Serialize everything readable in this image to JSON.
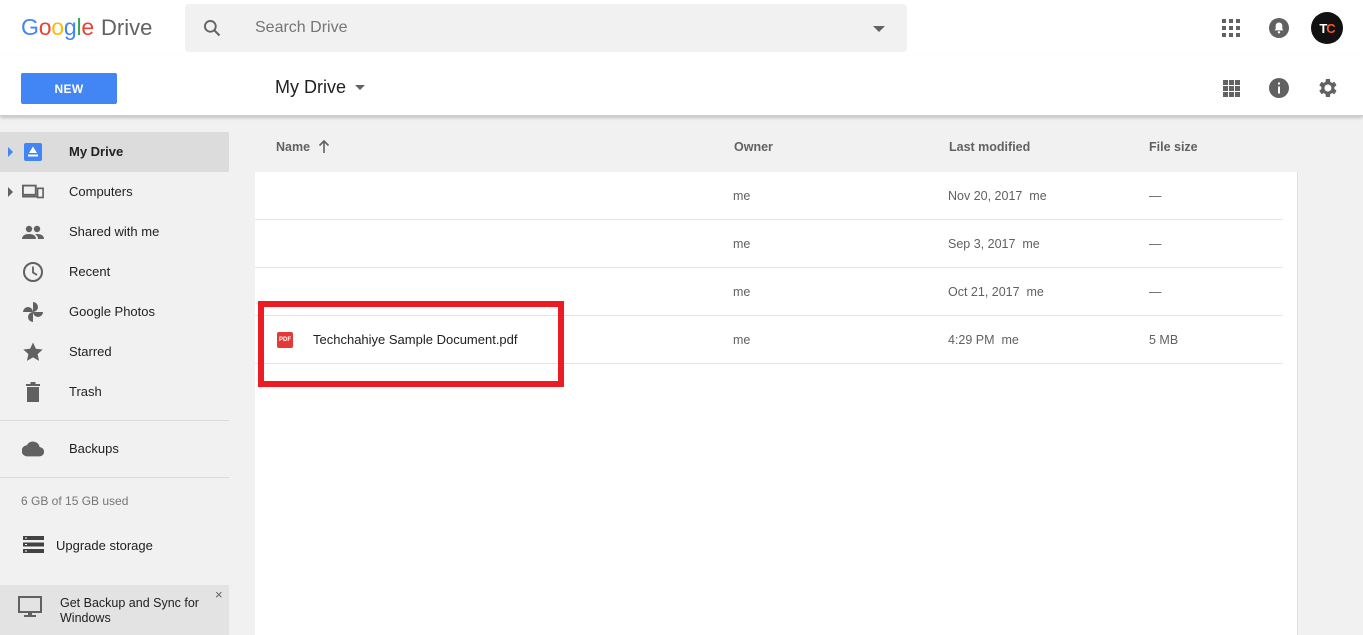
{
  "app": {
    "logo_google": "Google",
    "logo_drive": "Drive"
  },
  "search": {
    "placeholder": "Search Drive"
  },
  "account": {
    "avatar_left": "T",
    "avatar_right": "C"
  },
  "toolbar": {
    "new_label": "NEW",
    "location_title": "My Drive"
  },
  "sidebar": {
    "items": [
      {
        "label": "My Drive",
        "icon": "drive-icon"
      },
      {
        "label": "Computers",
        "icon": "computers-icon"
      },
      {
        "label": "Shared with me",
        "icon": "people-icon"
      },
      {
        "label": "Recent",
        "icon": "clock-icon"
      },
      {
        "label": "Google Photos",
        "icon": "photos-pinwheel-icon"
      },
      {
        "label": "Starred",
        "icon": "star-icon"
      },
      {
        "label": "Trash",
        "icon": "trash-icon"
      }
    ],
    "backups_label": "Backups",
    "storage_text": "6 GB of 15 GB used",
    "upgrade_label": "Upgrade storage",
    "sync_text": "Get Backup and Sync for Windows",
    "sync_close": "×"
  },
  "table": {
    "headers": {
      "name": "Name",
      "owner": "Owner",
      "modified": "Last modified",
      "size": "File size"
    },
    "rows": [
      {
        "name": "",
        "owner": "me",
        "modified": "Nov 20, 2017  me",
        "size": "—"
      },
      {
        "name": "",
        "owner": "me",
        "modified": "Sep 3, 2017  me",
        "size": "—"
      },
      {
        "name": "",
        "owner": "me",
        "modified": "Oct 21, 2017  me",
        "size": "—"
      },
      {
        "name": "Techchahiye Sample Document.pdf",
        "owner": "me",
        "modified": "4:29 PM  me",
        "size": "5 MB",
        "file_badge": "PDF"
      }
    ]
  },
  "colors": {
    "accent": "#4285f4",
    "highlight_box": "#ed1c24",
    "pdf_red": "#e53935"
  }
}
